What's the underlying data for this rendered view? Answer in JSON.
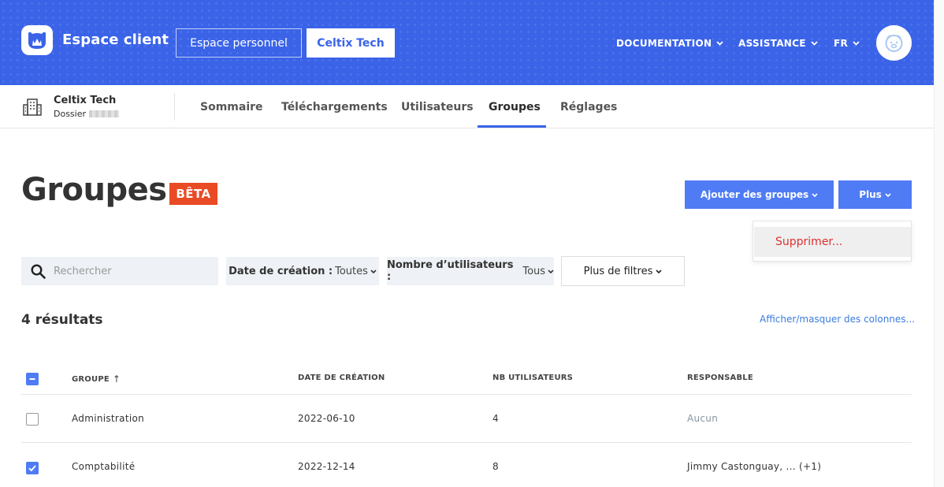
{
  "header": {
    "brand": "Espace client",
    "personal_space_label": "Espace personnel",
    "org_button_label": "Celtix Tech",
    "nav": [
      {
        "label": "DOCUMENTATION"
      },
      {
        "label": "ASSISTANCE"
      },
      {
        "label": "FR"
      }
    ]
  },
  "account": {
    "name": "Celtix Tech",
    "folder_label": "Dossier"
  },
  "tabs": [
    {
      "label": "Sommaire"
    },
    {
      "label": "Téléchargements"
    },
    {
      "label": "Utilisateurs"
    },
    {
      "label": "Groupes",
      "active": true
    },
    {
      "label": "Réglages"
    }
  ],
  "page": {
    "title": "Groupes",
    "badge": "BÊTA",
    "add_groups_label": "Ajouter des groupes",
    "more_label": "Plus",
    "dropdown": {
      "delete_label": "Supprimer..."
    }
  },
  "filters": {
    "search_placeholder": "Rechercher",
    "creation_date": {
      "label": "Date de création :",
      "value": "Toutes"
    },
    "user_count": {
      "label": "Nombre d’utilisateurs :",
      "value": "Tous"
    },
    "more_filters_label": "Plus de filtres"
  },
  "results": {
    "count_label": "4 résultats",
    "columns_link": "Afficher/masquer des colonnes..."
  },
  "table": {
    "columns": [
      "GROUPE",
      "DATE DE CRÉATION",
      "NB UTILISATEURS",
      "RESPONSABLE"
    ],
    "sort_indicator": "↑",
    "rows": [
      {
        "group": "Administration",
        "created": "2022-06-10",
        "users": "4",
        "owner": "Aucun",
        "checked": false
      },
      {
        "group": "Comptabilité",
        "created": "2022-12-14",
        "users": "8",
        "owner": "Jimmy Castonguay, ... (+1)",
        "checked": true
      }
    ]
  },
  "colors": {
    "primary": "#3a63e8",
    "button_blue": "#4f7cf5",
    "badge": "#e94b25",
    "danger": "#e03030",
    "link": "#3a7be0"
  }
}
